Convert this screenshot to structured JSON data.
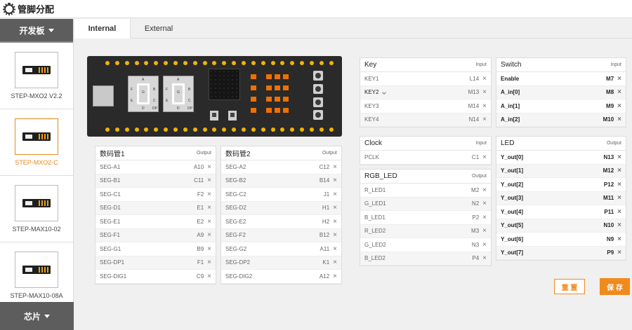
{
  "app": {
    "title": "管脚分配"
  },
  "sidebar": {
    "header": "开发板",
    "footer": "芯片",
    "boards": [
      {
        "label": "STEP-MXO2 V2.2",
        "active": false
      },
      {
        "label": "STEP-MXO2-C",
        "active": true
      },
      {
        "label": "STEP-MAX10-02",
        "active": false
      },
      {
        "label": "STEP-MAX10-08A",
        "active": false
      }
    ]
  },
  "tabs": [
    {
      "label": "Internal",
      "active": true
    },
    {
      "label": "External",
      "active": false
    }
  ],
  "board_image": {
    "seg_labels": [
      "A",
      "F",
      "G",
      "B",
      "E",
      "C",
      "D",
      "DP"
    ]
  },
  "panels": {
    "seg1": {
      "title": "数码管1",
      "kind": "Output",
      "rows": [
        {
          "name": "SEG-A1",
          "pin": "A10"
        },
        {
          "name": "SEG-B1",
          "pin": "C11"
        },
        {
          "name": "SEG-C1",
          "pin": "F2"
        },
        {
          "name": "SEG-D1",
          "pin": "E1"
        },
        {
          "name": "SEG-E1",
          "pin": "E2"
        },
        {
          "name": "SEG-F1",
          "pin": "A9"
        },
        {
          "name": "SEG-G1",
          "pin": "B9"
        },
        {
          "name": "SEG-DP1",
          "pin": "F1"
        },
        {
          "name": "SEG-DIG1",
          "pin": "C9"
        }
      ]
    },
    "seg2": {
      "title": "数码管2",
      "kind": "Output",
      "rows": [
        {
          "name": "SEG-A2",
          "pin": "C12"
        },
        {
          "name": "SEG-B2",
          "pin": "B14"
        },
        {
          "name": "SEG-C2",
          "pin": "J1"
        },
        {
          "name": "SEG-D2",
          "pin": "H1"
        },
        {
          "name": "SEG-E2",
          "pin": "H2"
        },
        {
          "name": "SEG-F2",
          "pin": "B12"
        },
        {
          "name": "SEG-G2",
          "pin": "A11"
        },
        {
          "name": "SEG-DP2",
          "pin": "K1"
        },
        {
          "name": "SEG-DIG2",
          "pin": "A12"
        }
      ]
    },
    "key": {
      "title": "Key",
      "kind": "Input",
      "rows": [
        {
          "name": "KEY1",
          "pin": "L14"
        },
        {
          "name": "KEY2",
          "pin": "M13"
        },
        {
          "name": "KEY3",
          "pin": "M14"
        },
        {
          "name": "KEY4",
          "pin": "N14"
        }
      ]
    },
    "clock": {
      "title": "Clock",
      "kind": "Input",
      "rows": [
        {
          "name": "PCLK",
          "pin": "C1"
        }
      ]
    },
    "rgb": {
      "title": "RGB_LED",
      "kind": "Output",
      "rows": [
        {
          "name": "R_LED1",
          "pin": "M2"
        },
        {
          "name": "G_LED1",
          "pin": "N2"
        },
        {
          "name": "B_LED1",
          "pin": "P2"
        },
        {
          "name": "R_LED2",
          "pin": "M3"
        },
        {
          "name": "G_LED2",
          "pin": "N3"
        },
        {
          "name": "B_LED2",
          "pin": "P4"
        }
      ]
    },
    "switch": {
      "title": "Switch",
      "kind": "Input",
      "rows": [
        {
          "name": "Enable",
          "pin": "M7"
        },
        {
          "name": "A_in[0]",
          "pin": "M8"
        },
        {
          "name": "A_in[1]",
          "pin": "M9"
        },
        {
          "name": "A_in[2]",
          "pin": "M10"
        }
      ]
    },
    "led": {
      "title": "LED",
      "kind": "Output",
      "rows": [
        {
          "name": "Y_out[0]",
          "pin": "N13"
        },
        {
          "name": "Y_out[1]",
          "pin": "M12"
        },
        {
          "name": "Y_out[2]",
          "pin": "P12"
        },
        {
          "name": "Y_out[3]",
          "pin": "M11"
        },
        {
          "name": "Y_out[4]",
          "pin": "P11"
        },
        {
          "name": "Y_out[5]",
          "pin": "N10"
        },
        {
          "name": "Y_out[6]",
          "pin": "N9"
        },
        {
          "name": "Y_out[7]",
          "pin": "P9"
        }
      ]
    }
  },
  "actions": {
    "reset": "重 置",
    "save": "保 存"
  },
  "remove_glyph": "×",
  "colors": {
    "accent": "#f08a1c",
    "sidebar_dark": "#5d5d5d",
    "pcb": "#2a2a2a",
    "pin": "#f2b400",
    "led": "#f07000"
  }
}
